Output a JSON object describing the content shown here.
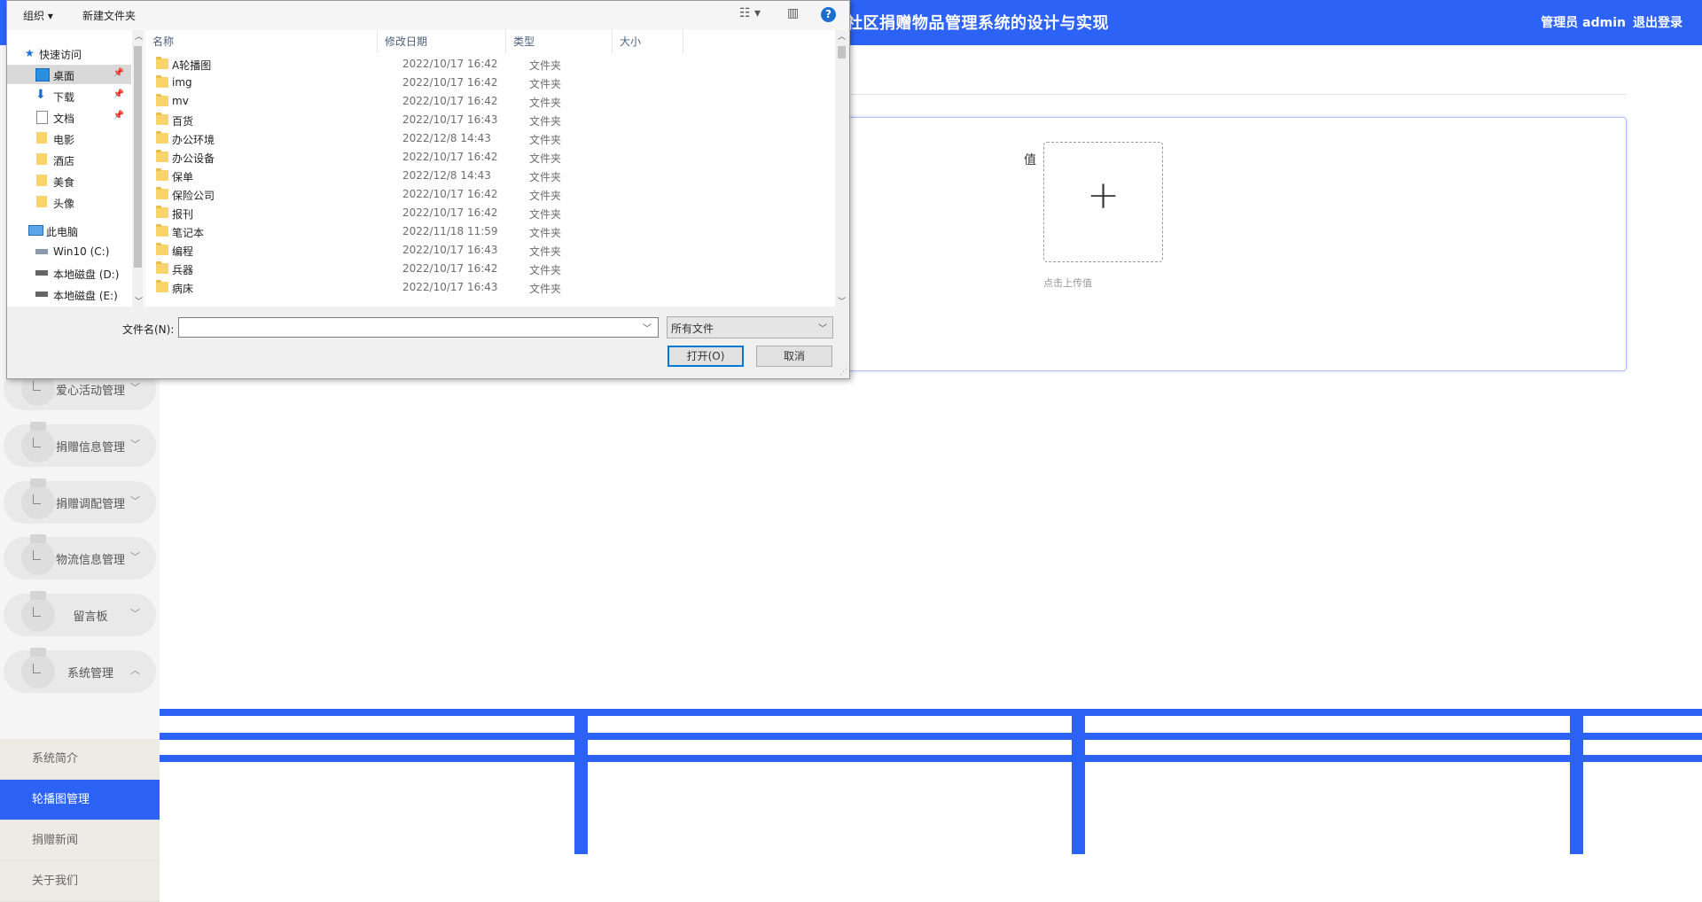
{
  "app": {
    "title": "社区捐赠物品管理系统的设计与实现",
    "user": "管理员 admin",
    "logout": "退出登录"
  },
  "sidebar": {
    "menus": [
      {
        "label": "爱心活动管理"
      },
      {
        "label": "捐赠信息管理"
      },
      {
        "label": "捐赠调配管理"
      },
      {
        "label": "物流信息管理"
      },
      {
        "label": "留言板"
      },
      {
        "label": "系统管理"
      }
    ],
    "submenu": [
      {
        "label": "系统简介"
      },
      {
        "label": "轮播图管理"
      },
      {
        "label": "捐赠新闻"
      },
      {
        "label": "关于我们"
      }
    ]
  },
  "form": {
    "value_label": "值",
    "upload_hint": "点击上传值"
  },
  "dialog": {
    "toolbar": {
      "organize": "组织 ▾",
      "new_folder": "新建文件夹",
      "help": "?"
    },
    "nav": {
      "quick_access": "快速访问",
      "items": [
        "桌面",
        "下载",
        "文档",
        "电影",
        "酒店",
        "美食",
        "头像"
      ],
      "this_pc": "此电脑",
      "drives": [
        "Win10 (C:)",
        "本地磁盘 (D:)",
        "本地磁盘 (E:)"
      ]
    },
    "columns": {
      "name": "名称",
      "date": "修改日期",
      "type": "类型",
      "size": "大小"
    },
    "files": [
      {
        "name": "A轮播图",
        "date": "2022/10/17 16:42",
        "type": "文件夹"
      },
      {
        "name": "img",
        "date": "2022/10/17 16:42",
        "type": "文件夹"
      },
      {
        "name": "mv",
        "date": "2022/10/17 16:42",
        "type": "文件夹"
      },
      {
        "name": "百货",
        "date": "2022/10/17 16:43",
        "type": "文件夹"
      },
      {
        "name": "办公环境",
        "date": "2022/12/8 14:43",
        "type": "文件夹"
      },
      {
        "name": "办公设备",
        "date": "2022/10/17 16:42",
        "type": "文件夹"
      },
      {
        "name": "保单",
        "date": "2022/12/8 14:43",
        "type": "文件夹"
      },
      {
        "name": "保险公司",
        "date": "2022/10/17 16:42",
        "type": "文件夹"
      },
      {
        "name": "报刊",
        "date": "2022/10/17 16:42",
        "type": "文件夹"
      },
      {
        "name": "笔记本",
        "date": "2022/11/18 11:59",
        "type": "文件夹"
      },
      {
        "name": "编程",
        "date": "2022/10/17 16:43",
        "type": "文件夹"
      },
      {
        "name": "兵器",
        "date": "2022/10/17 16:42",
        "type": "文件夹"
      },
      {
        "name": "病床",
        "date": "2022/10/17 16:43",
        "type": "文件夹"
      }
    ],
    "filename_label": "文件名(N):",
    "filename_value": "",
    "filetype": "所有文件",
    "open": "打开(O)",
    "cancel": "取消"
  },
  "colors": {
    "accent": "#2c62f6"
  }
}
